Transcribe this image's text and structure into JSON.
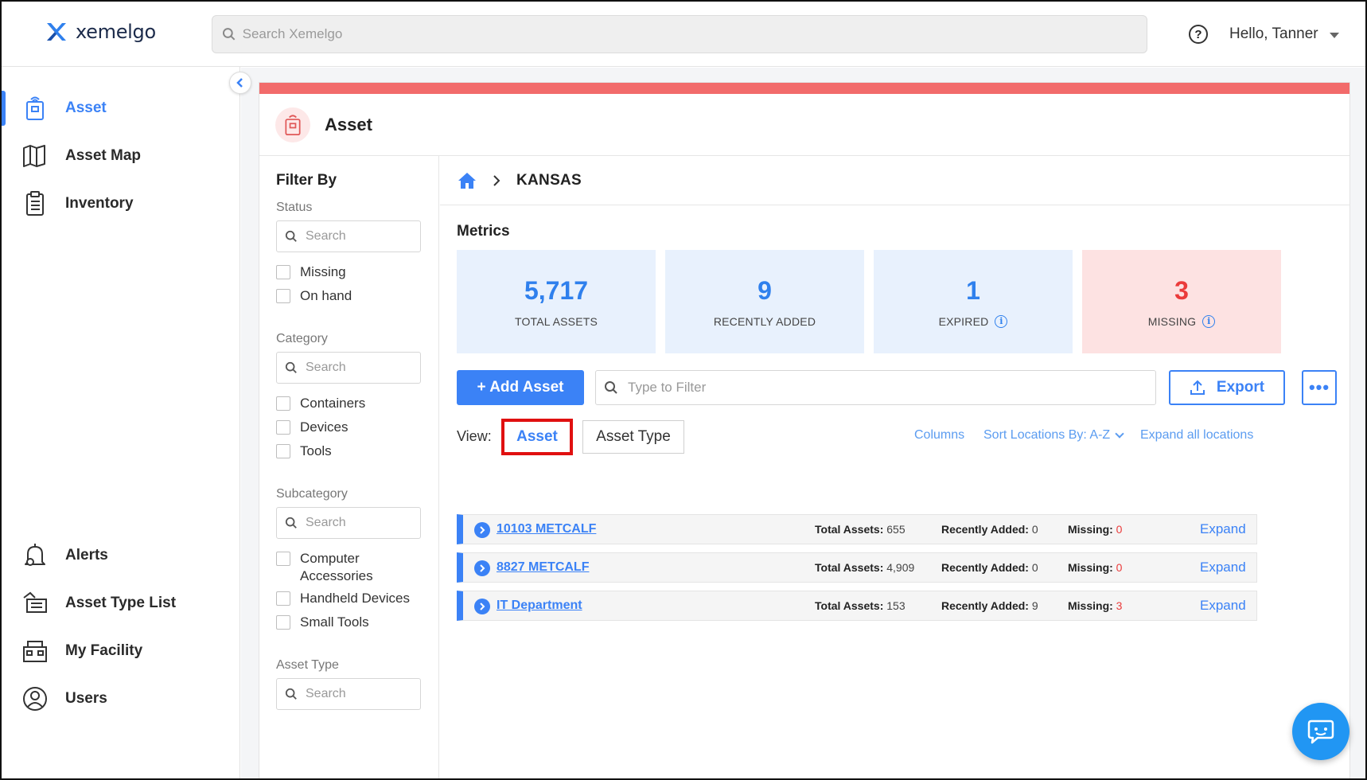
{
  "app": {
    "logo_text": "xemelgo",
    "search_placeholder": "Search Xemelgo",
    "user_greeting": "Hello, Tanner",
    "accent_color": "#3b82f6",
    "alert_color": "#eb3b3b",
    "highlight_color": "#e01010"
  },
  "sidebar": {
    "items": [
      {
        "label": "Asset",
        "icon": "asset-tag-icon",
        "active": true
      },
      {
        "label": "Asset Map",
        "icon": "map-icon",
        "active": false
      },
      {
        "label": "Inventory",
        "icon": "clipboard-icon",
        "active": false
      },
      {
        "label": "Alerts",
        "icon": "bell-icon",
        "active": false
      },
      {
        "label": "Asset Type List",
        "icon": "asset-type-list-icon",
        "active": false
      },
      {
        "label": "My Facility",
        "icon": "facility-icon",
        "active": false
      },
      {
        "label": "Users",
        "icon": "user-icon",
        "active": false
      }
    ]
  },
  "page": {
    "title": "Asset",
    "breadcrumb": {
      "current": "KANSAS"
    }
  },
  "filters": {
    "heading": "Filter By",
    "search_placeholder": "Search",
    "groups": [
      {
        "label": "Status",
        "options": [
          "Missing",
          "On hand"
        ]
      },
      {
        "label": "Category",
        "options": [
          "Containers",
          "Devices",
          "Tools"
        ]
      },
      {
        "label": "Subcategory",
        "options": [
          "Computer Accessories",
          "Handheld Devices",
          "Small Tools"
        ]
      },
      {
        "label": "Asset Type",
        "options": []
      }
    ]
  },
  "metrics": {
    "title": "Metrics",
    "cards": [
      {
        "value": "5,717",
        "label": "TOTAL ASSETS",
        "info": false
      },
      {
        "value": "9",
        "label": "RECENTLY ADDED",
        "info": false
      },
      {
        "value": "1",
        "label": "EXPIRED",
        "info": true
      },
      {
        "value": "3",
        "label": "MISSING",
        "info": true
      }
    ]
  },
  "toolbar": {
    "add_label": "+ Add Asset",
    "filter_placeholder": "Type to Filter",
    "export_label": "Export",
    "more_label": "•••"
  },
  "view": {
    "label": "View:",
    "asset_label": "Asset",
    "asset_type_label": "Asset Type",
    "columns_label": "Columns",
    "sort_label": "Sort Locations By: A-Z",
    "expand_all_label": "Expand all locations"
  },
  "locations": [
    {
      "name": "10103 METCALF",
      "total_label": "Total Assets:",
      "total": "655",
      "recent_label": "Recently Added:",
      "recent": "0",
      "missing_label": "Missing:",
      "missing": "0",
      "expand": "Expand"
    },
    {
      "name": "8827 METCALF",
      "total_label": "Total Assets:",
      "total": "4,909",
      "recent_label": "Recently Added:",
      "recent": "0",
      "missing_label": "Missing:",
      "missing": "0",
      "expand": "Expand"
    },
    {
      "name": "IT Department",
      "total_label": "Total Assets:",
      "total": "153",
      "recent_label": "Recently Added:",
      "recent": "9",
      "missing_label": "Missing:",
      "missing": "3",
      "expand": "Expand"
    }
  ]
}
